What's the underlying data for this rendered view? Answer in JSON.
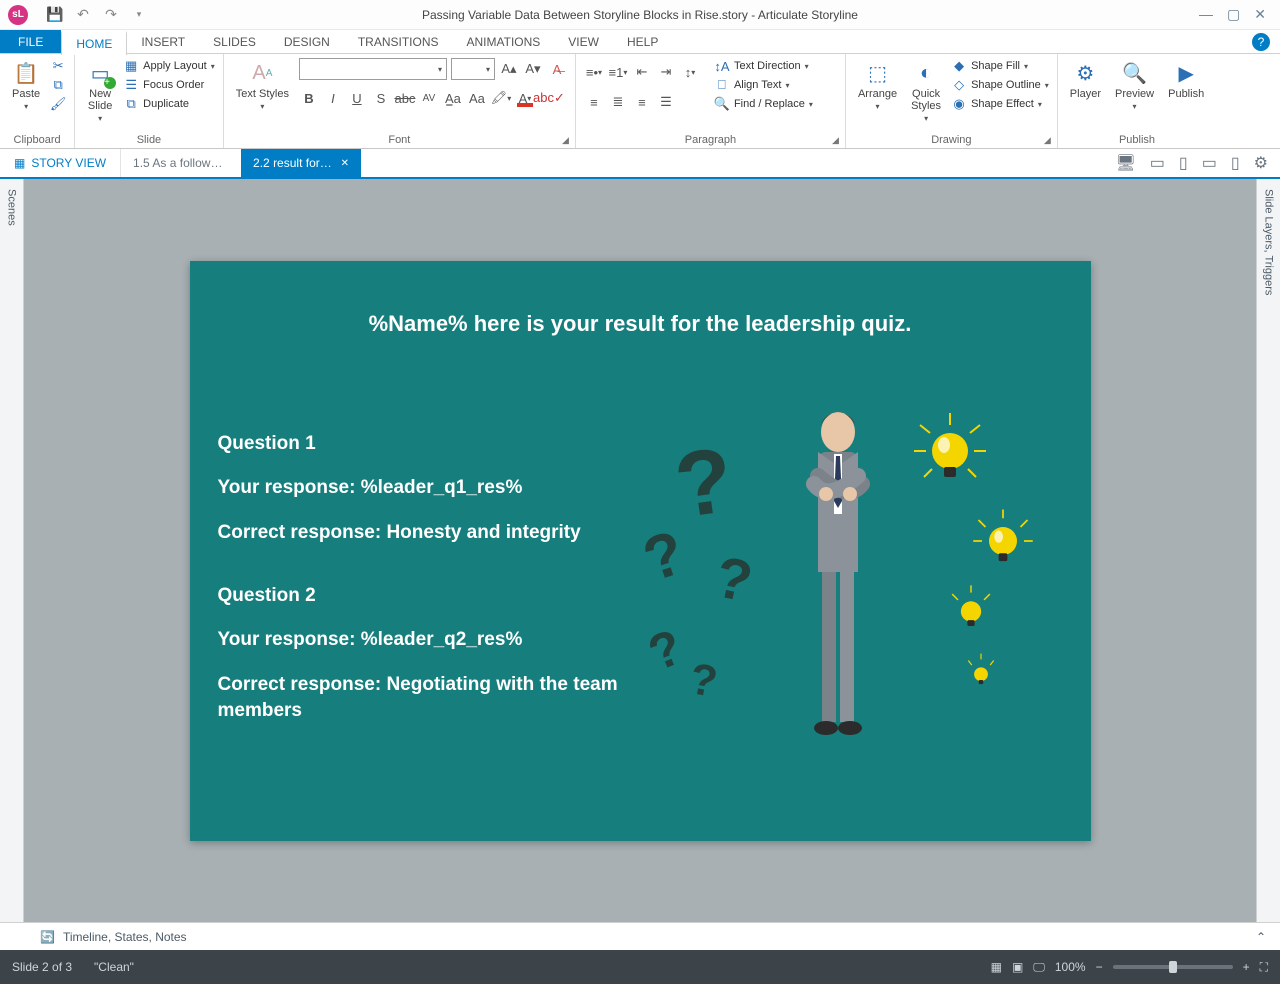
{
  "title": "Passing Variable Data Between Storyline Blocks in Rise.story  -  Articulate Storyline",
  "app_icon_label": "sL",
  "tabs": {
    "file": "FILE",
    "home": "HOME",
    "insert": "INSERT",
    "slides": "SLIDES",
    "design": "DESIGN",
    "transitions": "TRANSITIONS",
    "animations": "ANIMATIONS",
    "view": "VIEW",
    "help": "HELP"
  },
  "ribbon": {
    "clipboard": {
      "label": "Clipboard",
      "paste": "Paste",
      "cut": "Cut",
      "copy": "Copy",
      "format_painter": "Format Painter"
    },
    "slide": {
      "label": "Slide",
      "new_slide": "New\nSlide",
      "apply_layout": "Apply Layout",
      "focus_order": "Focus Order",
      "duplicate": "Duplicate"
    },
    "font": {
      "label": "Font",
      "text_styles": "Text Styles"
    },
    "paragraph": {
      "label": "Paragraph",
      "text_direction": "Text Direction",
      "align_text": "Align Text",
      "find_replace": "Find / Replace"
    },
    "drawing": {
      "label": "Drawing",
      "arrange": "Arrange",
      "quick_styles": "Quick\nStyles",
      "shape_fill": "Shape Fill",
      "shape_outline": "Shape Outline",
      "shape_effect": "Shape Effect"
    },
    "publish": {
      "label": "Publish",
      "player": "Player",
      "preview": "Preview",
      "publish_btn": "Publish"
    }
  },
  "subbar": {
    "story_view": "STORY VIEW",
    "tab1": "1.5 As a follower…",
    "tab2": "2.2 result for t…"
  },
  "side": {
    "left": "Scenes",
    "right": "Slide Layers, Triggers"
  },
  "slide": {
    "heading": "%Name% here is your result for the leadership quiz.",
    "q1_title": "Question 1",
    "q1_your": "Your response: %leader_q1_res%",
    "q1_correct": "Correct response: Honesty and integrity",
    "q2_title": "Question 2",
    "q2_your": "Your response: %leader_q2_res%",
    "q2_correct": "Correct response: Negotiating with the team members"
  },
  "timeline": "Timeline, States, Notes",
  "status": {
    "slide": "Slide 2 of 3",
    "layout": "\"Clean\"",
    "zoom": "100%"
  }
}
